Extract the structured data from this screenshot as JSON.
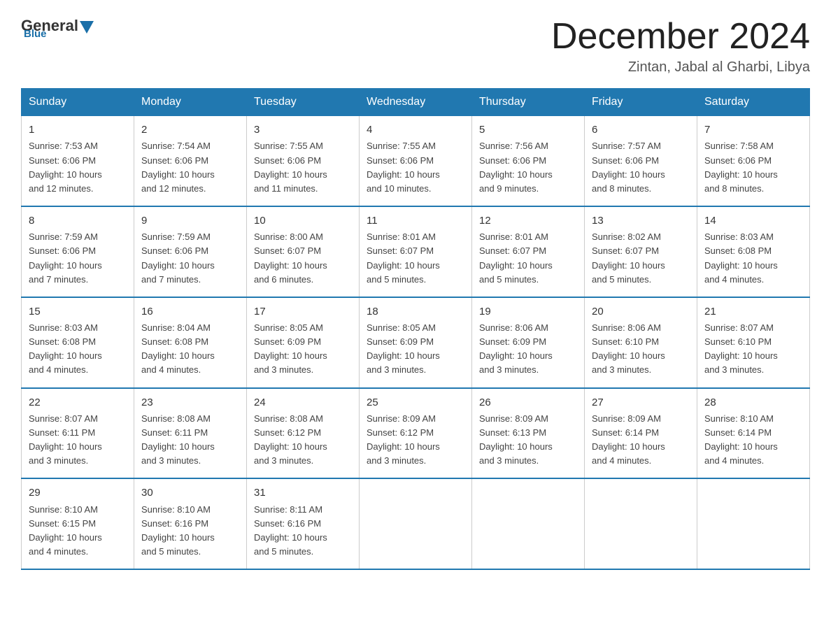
{
  "header": {
    "logo_general": "General",
    "logo_blue": "Blue",
    "month_title": "December 2024",
    "location": "Zintan, Jabal al Gharbi, Libya"
  },
  "days_of_week": [
    "Sunday",
    "Monday",
    "Tuesday",
    "Wednesday",
    "Thursday",
    "Friday",
    "Saturday"
  ],
  "weeks": [
    [
      {
        "day": "1",
        "sunrise": "7:53 AM",
        "sunset": "6:06 PM",
        "daylight": "10 hours and 12 minutes."
      },
      {
        "day": "2",
        "sunrise": "7:54 AM",
        "sunset": "6:06 PM",
        "daylight": "10 hours and 12 minutes."
      },
      {
        "day": "3",
        "sunrise": "7:55 AM",
        "sunset": "6:06 PM",
        "daylight": "10 hours and 11 minutes."
      },
      {
        "day": "4",
        "sunrise": "7:55 AM",
        "sunset": "6:06 PM",
        "daylight": "10 hours and 10 minutes."
      },
      {
        "day": "5",
        "sunrise": "7:56 AM",
        "sunset": "6:06 PM",
        "daylight": "10 hours and 9 minutes."
      },
      {
        "day": "6",
        "sunrise": "7:57 AM",
        "sunset": "6:06 PM",
        "daylight": "10 hours and 8 minutes."
      },
      {
        "day": "7",
        "sunrise": "7:58 AM",
        "sunset": "6:06 PM",
        "daylight": "10 hours and 8 minutes."
      }
    ],
    [
      {
        "day": "8",
        "sunrise": "7:59 AM",
        "sunset": "6:06 PM",
        "daylight": "10 hours and 7 minutes."
      },
      {
        "day": "9",
        "sunrise": "7:59 AM",
        "sunset": "6:06 PM",
        "daylight": "10 hours and 7 minutes."
      },
      {
        "day": "10",
        "sunrise": "8:00 AM",
        "sunset": "6:07 PM",
        "daylight": "10 hours and 6 minutes."
      },
      {
        "day": "11",
        "sunrise": "8:01 AM",
        "sunset": "6:07 PM",
        "daylight": "10 hours and 5 minutes."
      },
      {
        "day": "12",
        "sunrise": "8:01 AM",
        "sunset": "6:07 PM",
        "daylight": "10 hours and 5 minutes."
      },
      {
        "day": "13",
        "sunrise": "8:02 AM",
        "sunset": "6:07 PM",
        "daylight": "10 hours and 5 minutes."
      },
      {
        "day": "14",
        "sunrise": "8:03 AM",
        "sunset": "6:08 PM",
        "daylight": "10 hours and 4 minutes."
      }
    ],
    [
      {
        "day": "15",
        "sunrise": "8:03 AM",
        "sunset": "6:08 PM",
        "daylight": "10 hours and 4 minutes."
      },
      {
        "day": "16",
        "sunrise": "8:04 AM",
        "sunset": "6:08 PM",
        "daylight": "10 hours and 4 minutes."
      },
      {
        "day": "17",
        "sunrise": "8:05 AM",
        "sunset": "6:09 PM",
        "daylight": "10 hours and 3 minutes."
      },
      {
        "day": "18",
        "sunrise": "8:05 AM",
        "sunset": "6:09 PM",
        "daylight": "10 hours and 3 minutes."
      },
      {
        "day": "19",
        "sunrise": "8:06 AM",
        "sunset": "6:09 PM",
        "daylight": "10 hours and 3 minutes."
      },
      {
        "day": "20",
        "sunrise": "8:06 AM",
        "sunset": "6:10 PM",
        "daylight": "10 hours and 3 minutes."
      },
      {
        "day": "21",
        "sunrise": "8:07 AM",
        "sunset": "6:10 PM",
        "daylight": "10 hours and 3 minutes."
      }
    ],
    [
      {
        "day": "22",
        "sunrise": "8:07 AM",
        "sunset": "6:11 PM",
        "daylight": "10 hours and 3 minutes."
      },
      {
        "day": "23",
        "sunrise": "8:08 AM",
        "sunset": "6:11 PM",
        "daylight": "10 hours and 3 minutes."
      },
      {
        "day": "24",
        "sunrise": "8:08 AM",
        "sunset": "6:12 PM",
        "daylight": "10 hours and 3 minutes."
      },
      {
        "day": "25",
        "sunrise": "8:09 AM",
        "sunset": "6:12 PM",
        "daylight": "10 hours and 3 minutes."
      },
      {
        "day": "26",
        "sunrise": "8:09 AM",
        "sunset": "6:13 PM",
        "daylight": "10 hours and 3 minutes."
      },
      {
        "day": "27",
        "sunrise": "8:09 AM",
        "sunset": "6:14 PM",
        "daylight": "10 hours and 4 minutes."
      },
      {
        "day": "28",
        "sunrise": "8:10 AM",
        "sunset": "6:14 PM",
        "daylight": "10 hours and 4 minutes."
      }
    ],
    [
      {
        "day": "29",
        "sunrise": "8:10 AM",
        "sunset": "6:15 PM",
        "daylight": "10 hours and 4 minutes."
      },
      {
        "day": "30",
        "sunrise": "8:10 AM",
        "sunset": "6:16 PM",
        "daylight": "10 hours and 5 minutes."
      },
      {
        "day": "31",
        "sunrise": "8:11 AM",
        "sunset": "6:16 PM",
        "daylight": "10 hours and 5 minutes."
      },
      null,
      null,
      null,
      null
    ]
  ],
  "labels": {
    "sunrise": "Sunrise:",
    "sunset": "Sunset:",
    "daylight": "Daylight:"
  }
}
